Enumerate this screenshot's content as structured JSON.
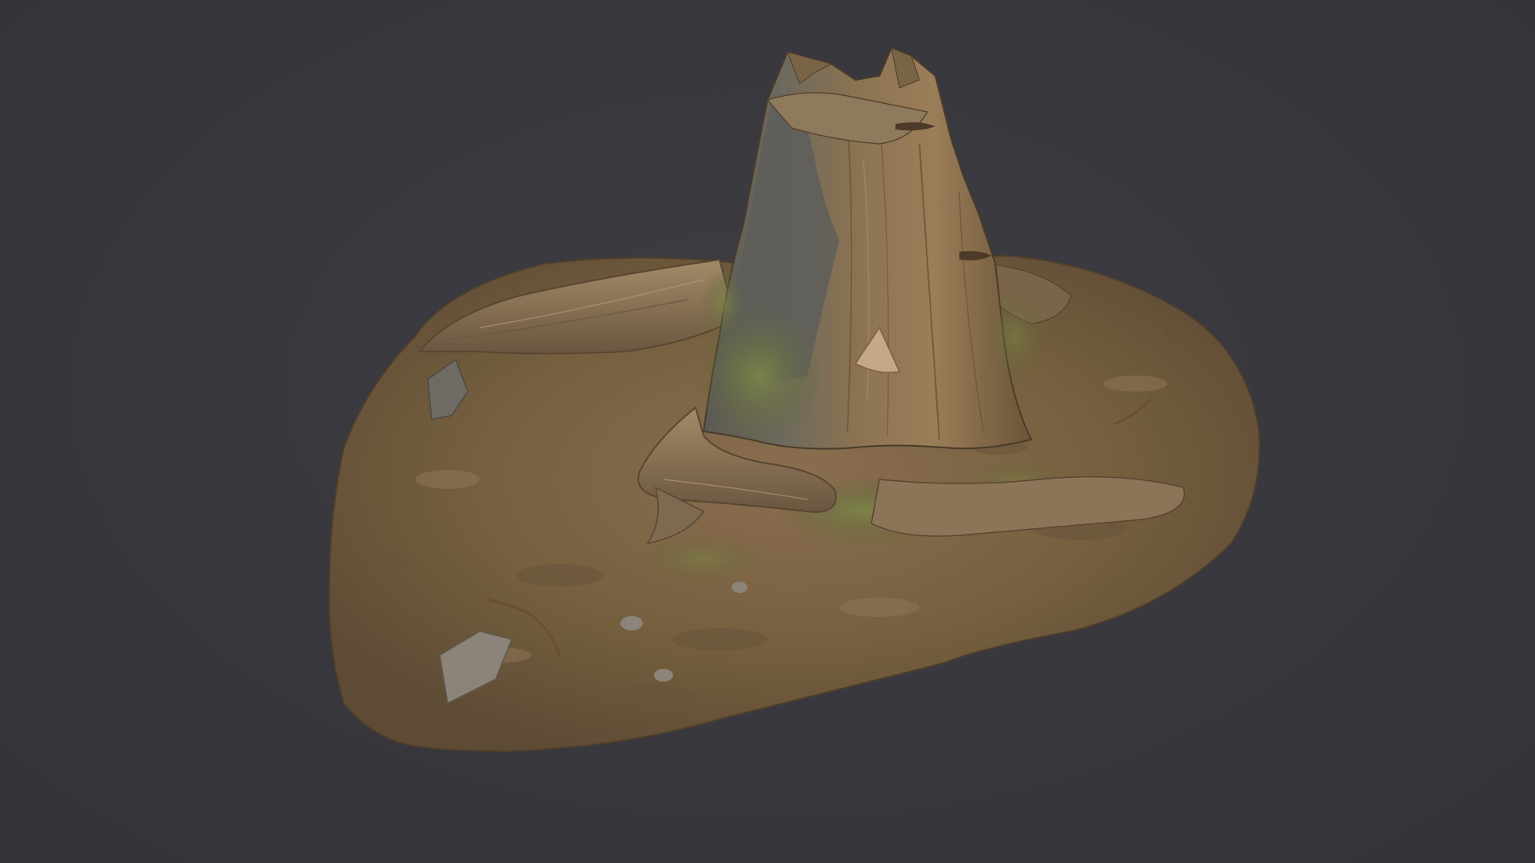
{
  "viewport": {
    "background_color": "#3a3a40"
  },
  "model": {
    "subject": "tree-stump-scan",
    "colors": {
      "ground": "#7a6248",
      "ground_dark": "#5e4a36",
      "ground_light": "#8f7556",
      "wood": "#8a7050",
      "wood_dark": "#5a4632",
      "wood_light": "#a48a66",
      "bark": "#5c5c58",
      "moss": "#6e7640",
      "rock": "#7c7670"
    }
  }
}
